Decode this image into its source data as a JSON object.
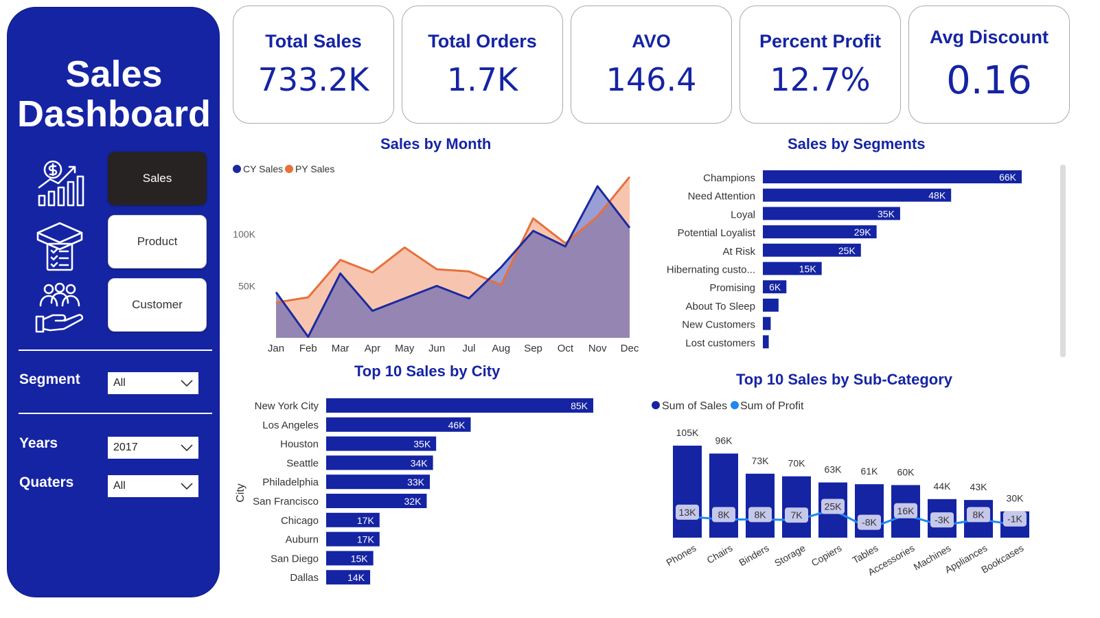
{
  "sidebar": {
    "title_line1": "Sales",
    "title_line2": "Dashboard",
    "nav": [
      {
        "label": "Sales",
        "icon": "sales-growth-icon",
        "active": true
      },
      {
        "label": "Product",
        "icon": "product-box-icon",
        "active": false
      },
      {
        "label": "Customer",
        "icon": "customer-hand-icon",
        "active": false
      }
    ],
    "filters": {
      "segment": {
        "label": "Segment",
        "value": "All"
      },
      "years": {
        "label": "Years",
        "value": "2017"
      },
      "quarters": {
        "label": "Quaters",
        "value": "All"
      }
    }
  },
  "kpis": [
    {
      "label": "Total Sales",
      "value": "733.2K"
    },
    {
      "label": "Total Orders",
      "value": "1.7K"
    },
    {
      "label": "AVO",
      "value": "146.4"
    },
    {
      "label": "Percent Profit",
      "value": "12.7%"
    },
    {
      "label": "Avg Discount",
      "value": "0.16"
    }
  ],
  "colors": {
    "brand": "#1524a3",
    "cy": "#1a2a9e",
    "py": "#e8703a",
    "profit": "#1e88f0",
    "nav_active": "#262322"
  },
  "chart_data": [
    {
      "type": "area",
      "title": "Sales by Month",
      "legend": [
        "CY Sales",
        "PY Sales"
      ],
      "legend_position": "top-left",
      "categories": [
        "Jan",
        "Feb",
        "Mar",
        "Apr",
        "May",
        "Jun",
        "Jul",
        "Aug",
        "Sep",
        "Oct",
        "Nov",
        "Dec"
      ],
      "series": [
        {
          "name": "CY Sales",
          "values": [
            44000,
            1000,
            62000,
            26000,
            38000,
            50000,
            38000,
            68000,
            103000,
            88000,
            146000,
            106000
          ]
        },
        {
          "name": "PY Sales",
          "values": [
            34000,
            39000,
            75000,
            63000,
            87000,
            66000,
            64000,
            51000,
            115000,
            91000,
            117000,
            155000
          ]
        }
      ],
      "ylim": [
        0,
        160000
      ],
      "yticks": [
        "50K",
        "100K"
      ],
      "ytick_values": [
        50000,
        100000
      ]
    },
    {
      "type": "bar",
      "orientation": "horizontal",
      "title": "Sales by Segments",
      "categories": [
        "Champions",
        "Need Attention",
        "Loyal",
        "Potential Loyalist",
        "At Risk",
        "Hibernating custo...",
        "Promising",
        "About To Sleep",
        "New Customers",
        "Lost customers"
      ],
      "values": [
        66000,
        48000,
        35000,
        29000,
        25000,
        15000,
        6000,
        4000,
        2000,
        1500
      ],
      "labels": [
        "66K",
        "48K",
        "35K",
        "29K",
        "25K",
        "15K",
        "6K",
        "",
        "",
        ""
      ]
    },
    {
      "type": "bar",
      "orientation": "horizontal",
      "title": "Top 10 Sales by City",
      "ylabel": "City",
      "categories": [
        "New York City",
        "Los Angeles",
        "Houston",
        "Seattle",
        "Philadelphia",
        "San Francisco",
        "Chicago",
        "Auburn",
        "San Diego",
        "Dallas"
      ],
      "values": [
        85000,
        46000,
        35000,
        34000,
        33000,
        32000,
        17000,
        17000,
        15000,
        14000
      ],
      "labels": [
        "85K",
        "46K",
        "35K",
        "34K",
        "33K",
        "32K",
        "17K",
        "17K",
        "15K",
        "14K"
      ]
    },
    {
      "type": "bar",
      "title": "Top 10 Sales by Sub-Category",
      "legend": [
        "Sum of Sales",
        "Sum of Profit"
      ],
      "legend_position": "top-left",
      "categories": [
        "Phones",
        "Chairs",
        "Binders",
        "Storage",
        "Copiers",
        "Tables",
        "Accessories",
        "Machines",
        "Appliances",
        "Bookcases"
      ],
      "series": [
        {
          "name": "Sum of Sales",
          "type": "bar",
          "values": [
            105000,
            96000,
            73000,
            70000,
            63000,
            61000,
            60000,
            44000,
            43000,
            30000
          ],
          "labels": [
            "105K",
            "96K",
            "73K",
            "70K",
            "63K",
            "61K",
            "60K",
            "44K",
            "43K",
            "30K"
          ]
        },
        {
          "name": "Sum of Profit",
          "type": "line",
          "values": [
            13000,
            8000,
            8000,
            7000,
            25000,
            -8000,
            16000,
            -3000,
            8000,
            -1000
          ],
          "labels": [
            "13K",
            "8K",
            "8K",
            "7K",
            "25K",
            "-8K",
            "16K",
            "-3K",
            "8K",
            "-1K"
          ]
        }
      ]
    }
  ]
}
